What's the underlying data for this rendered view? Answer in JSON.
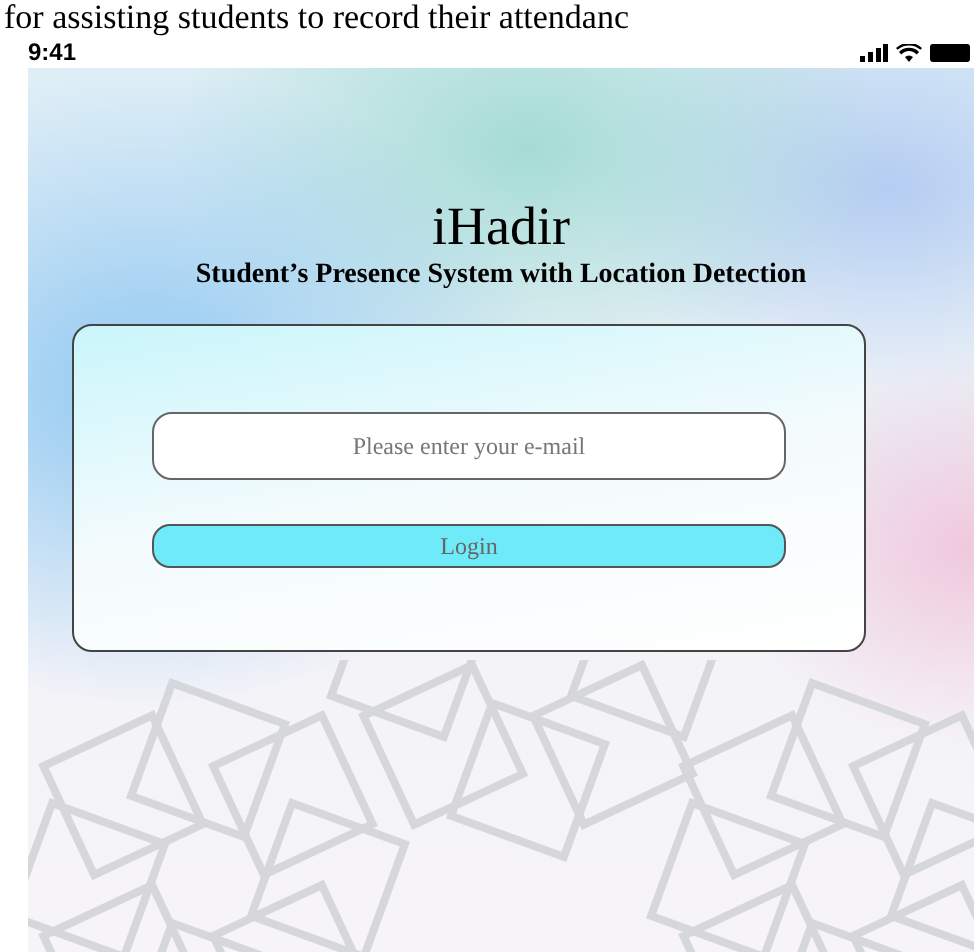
{
  "caption": "for assisting students to record their attendanc",
  "status_bar": {
    "time": "9:41"
  },
  "app": {
    "title": "iHadir",
    "subtitle": "Student’s Presence System with Location Detection"
  },
  "login_form": {
    "email": {
      "placeholder": "Please enter your e-mail"
    },
    "button": "Login"
  }
}
